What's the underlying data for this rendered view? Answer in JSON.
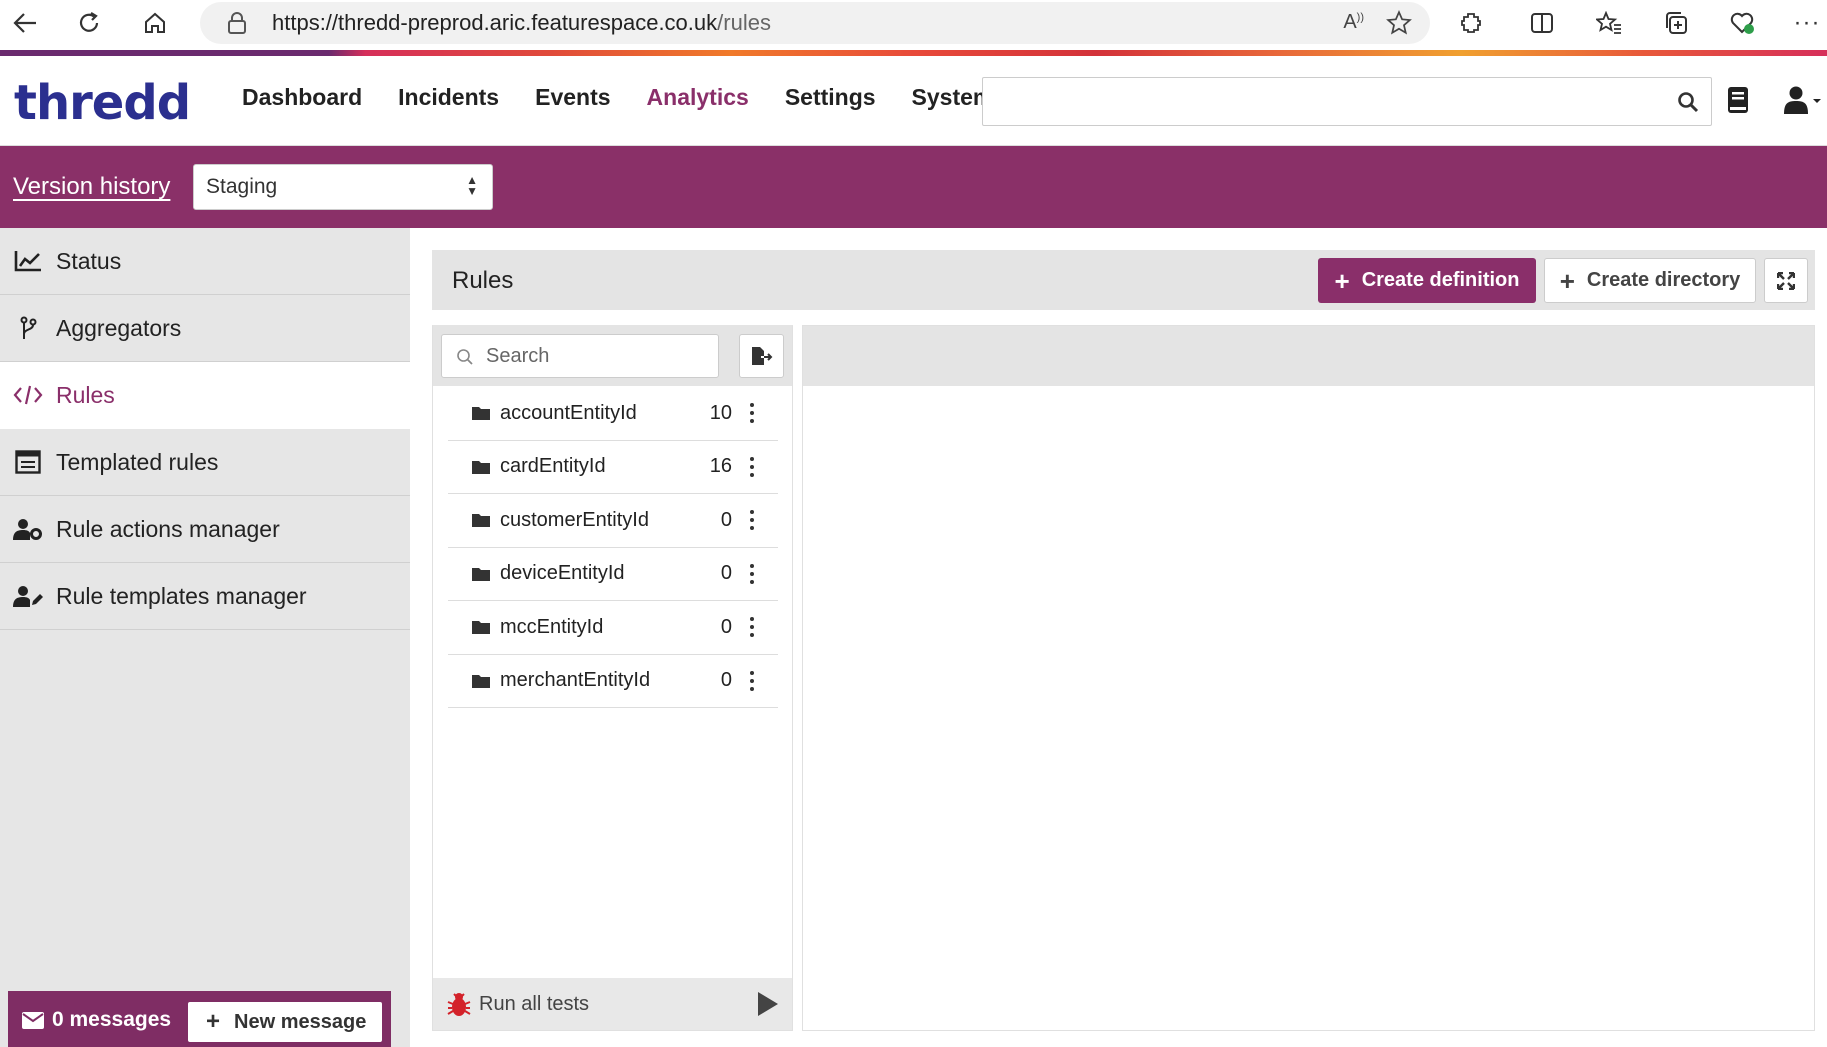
{
  "browser": {
    "url_host": "https://thredd-preprod.aric.featurespace.co.uk",
    "url_path": "/rules"
  },
  "app": {
    "logo": "thredd",
    "nav": [
      {
        "label": "Dashboard",
        "active": false
      },
      {
        "label": "Incidents",
        "active": false
      },
      {
        "label": "Events",
        "active": false
      },
      {
        "label": "Analytics",
        "active": true
      },
      {
        "label": "Settings",
        "active": false
      },
      {
        "label": "System",
        "active": false
      }
    ],
    "accent_color": "#8a2f6a"
  },
  "version_bar": {
    "link": "Version history",
    "environment": "Staging"
  },
  "sidebar": {
    "items": [
      {
        "label": "Status",
        "icon": "chart-line-icon",
        "active": false
      },
      {
        "label": "Aggregators",
        "icon": "branch-icon",
        "active": false
      },
      {
        "label": "Rules",
        "icon": "code-icon",
        "active": true
      },
      {
        "label": "Templated rules",
        "icon": "template-icon",
        "active": false
      },
      {
        "label": "Rule actions manager",
        "icon": "user-gear-icon",
        "active": false
      },
      {
        "label": "Rule templates manager",
        "icon": "user-edit-icon",
        "active": false
      }
    ],
    "messages": {
      "count_label": "0 messages",
      "new_button": "New message"
    }
  },
  "main": {
    "title": "Rules",
    "create_definition": "Create definition",
    "create_directory": "Create directory",
    "search_placeholder": "Search",
    "directories": [
      {
        "name": "accountEntityId",
        "count": "10"
      },
      {
        "name": "cardEntityId",
        "count": "16"
      },
      {
        "name": "customerEntityId",
        "count": "0"
      },
      {
        "name": "deviceEntityId",
        "count": "0"
      },
      {
        "name": "mccEntityId",
        "count": "0"
      },
      {
        "name": "merchantEntityId",
        "count": "0"
      }
    ],
    "run_all_tests": "Run all tests"
  }
}
